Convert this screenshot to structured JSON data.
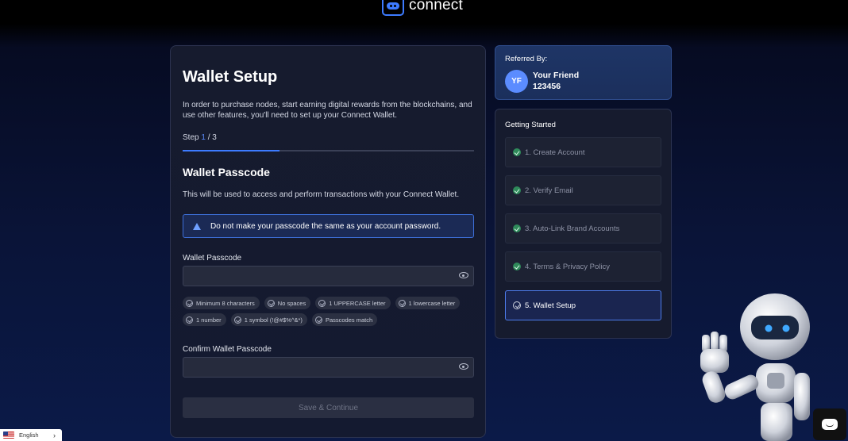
{
  "brand": {
    "name": "connect",
    "accent": "#3d7bff"
  },
  "setup": {
    "title": "Wallet Setup",
    "intro": "In order to purchase nodes, start earning digital rewards from the blockchains, and use other features, you'll need to set up your Connect Wallet.",
    "step_prefix": "Step",
    "step_current": "1",
    "step_sep": " / ",
    "step_total": "3",
    "progress_fraction": 0.333,
    "section_title": "Wallet Passcode",
    "section_desc": "This will be used to access and perform transactions with your Connect Wallet.",
    "alert_text": "Do not make your passcode the same as your account password.",
    "passcode_label": "Wallet Passcode",
    "passcode_value": "",
    "confirm_label": "Confirm Wallet Passcode",
    "confirm_value": "",
    "requirements": [
      "Minimum 8 characters",
      "No spaces",
      "1 UPPERCASE letter",
      "1 lowercase letter",
      "1 number",
      "1 symbol (!@#$%^&*)",
      "Passcodes match"
    ],
    "save_label": "Save & Continue"
  },
  "referral": {
    "label": "Referred By:",
    "initials": "YF",
    "name": "Your Friend",
    "code": "123456"
  },
  "getting_started": {
    "title": "Getting Started",
    "items": [
      {
        "label": "1. Create Account",
        "status": "done"
      },
      {
        "label": "2. Verify Email",
        "status": "done"
      },
      {
        "label": "3. Auto-Link Brand Accounts",
        "status": "done"
      },
      {
        "label": "4. Terms & Privacy Policy",
        "status": "done"
      },
      {
        "label": "5. Wallet Setup",
        "status": "active"
      }
    ]
  },
  "language": {
    "label": "English"
  }
}
